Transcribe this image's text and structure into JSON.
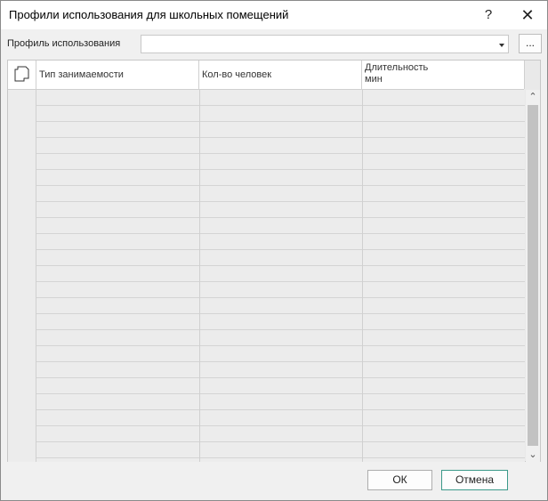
{
  "window": {
    "title": "Профили использования для школьных помещений",
    "help": "?",
    "close": "✕"
  },
  "profile": {
    "label": "Профиль использования",
    "value": "",
    "ellipsis": "..."
  },
  "grid": {
    "columns": [
      {
        "label": "Тип занимаемости",
        "line2": ""
      },
      {
        "label": "Кол-во человек",
        "line2": ""
      },
      {
        "label": "Длительность",
        "line2": "мин"
      }
    ],
    "rows": []
  },
  "buttons": {
    "ok": "ОК",
    "cancel": "Отмена"
  }
}
